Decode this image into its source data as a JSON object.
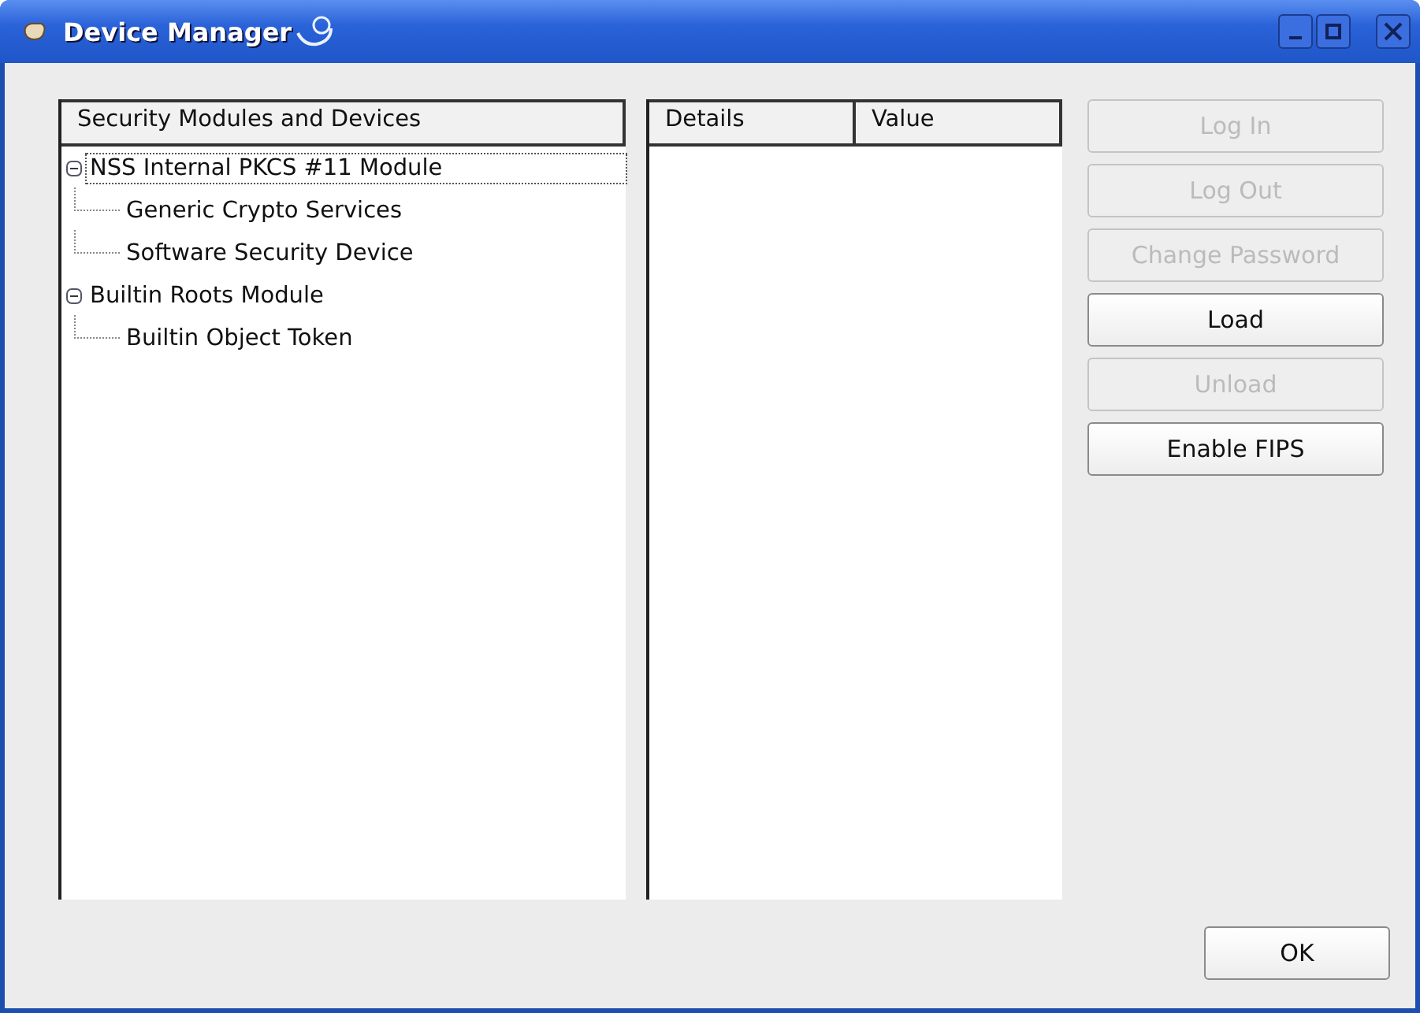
{
  "window": {
    "title": "Device Manager"
  },
  "tree": {
    "header": "Security Modules and Devices",
    "items": [
      {
        "label": "NSS Internal PKCS #11 Module",
        "expanded": true,
        "selected": true,
        "children": [
          {
            "label": "Generic Crypto Services",
            "selected": false
          },
          {
            "label": "Software Security Device",
            "selected": false
          }
        ]
      },
      {
        "label": "Builtin Roots Module",
        "expanded": true,
        "selected": false,
        "children": [
          {
            "label": "Builtin Object Token",
            "selected": false
          }
        ]
      }
    ]
  },
  "details": {
    "columns": [
      "Details",
      "Value"
    ]
  },
  "buttons": [
    {
      "label": "Log In",
      "disabled": true
    },
    {
      "label": "Log Out",
      "disabled": true
    },
    {
      "label": "Change Password",
      "disabled": true
    },
    {
      "label": "Load",
      "disabled": false
    },
    {
      "label": "Unload",
      "disabled": true
    },
    {
      "label": "Enable FIPS",
      "disabled": false
    }
  ],
  "ok": "OK"
}
